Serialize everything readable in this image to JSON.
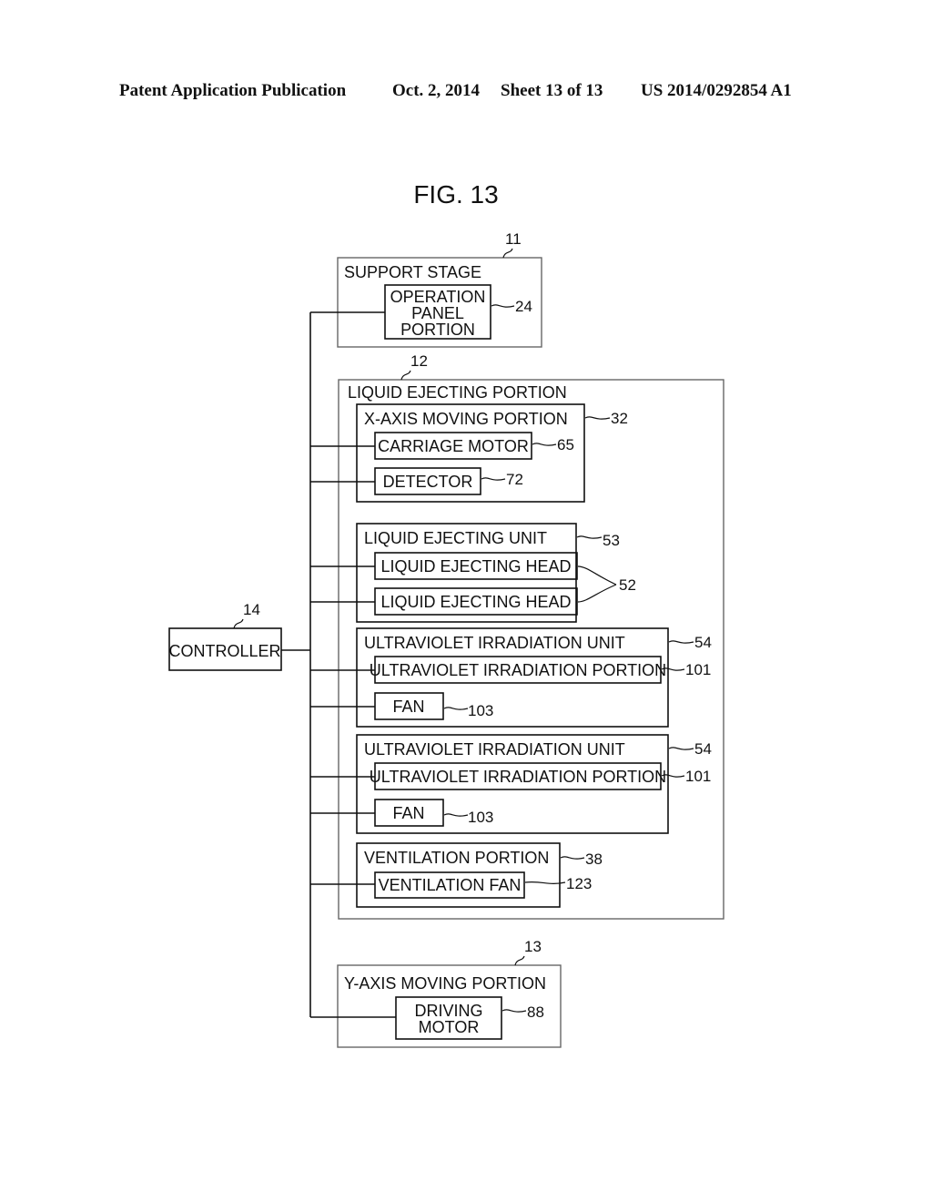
{
  "header": {
    "publication": "Patent Application Publication",
    "date": "Oct. 2, 2014",
    "sheet": "Sheet 13 of 13",
    "number": "US 2014/0292854 A1"
  },
  "figure": {
    "title": "FIG. 13"
  },
  "blocks": {
    "support_stage": {
      "label": "SUPPORT STAGE",
      "ref": "11"
    },
    "operation_panel": {
      "lines": [
        "OPERATION",
        "PANEL",
        "PORTION"
      ],
      "ref": "24"
    },
    "liquid_ejecting_portion": {
      "label": "LIQUID EJECTING PORTION",
      "ref": "12"
    },
    "x_axis_moving": {
      "label": "X-AXIS MOVING PORTION",
      "ref": "32"
    },
    "carriage_motor": {
      "label": "CARRIAGE MOTOR",
      "ref": "65"
    },
    "detector": {
      "label": "DETECTOR",
      "ref": "72"
    },
    "liquid_ejecting_unit": {
      "label": "LIQUID EJECTING UNIT",
      "ref": "53"
    },
    "liquid_ejecting_head_1": {
      "label": "LIQUID EJECTING HEAD"
    },
    "liquid_ejecting_head_2": {
      "label": "LIQUID EJECTING HEAD"
    },
    "heads_ref": "52",
    "uv_unit_1": {
      "label": "ULTRAVIOLET IRRADIATION UNIT",
      "ref": "54"
    },
    "uv_portion_1": {
      "label": "ULTRAVIOLET IRRADIATION PORTION",
      "ref": "101"
    },
    "fan_1": {
      "label": "FAN",
      "ref": "103"
    },
    "uv_unit_2": {
      "label": "ULTRAVIOLET IRRADIATION UNIT",
      "ref": "54"
    },
    "uv_portion_2": {
      "label": "ULTRAVIOLET IRRADIATION PORTION",
      "ref": "101"
    },
    "fan_2": {
      "label": "FAN",
      "ref": "103"
    },
    "ventilation_portion": {
      "label": "VENTILATION PORTION",
      "ref": "38"
    },
    "ventilation_fan": {
      "label": "VENTILATION FAN",
      "ref": "123"
    },
    "controller": {
      "label": "CONTROLLER",
      "ref": "14"
    },
    "y_axis_moving": {
      "label": "Y-AXIS MOVING PORTION",
      "ref": "13"
    },
    "driving_motor": {
      "lines": [
        "DRIVING",
        "MOTOR"
      ],
      "ref": "88"
    }
  }
}
